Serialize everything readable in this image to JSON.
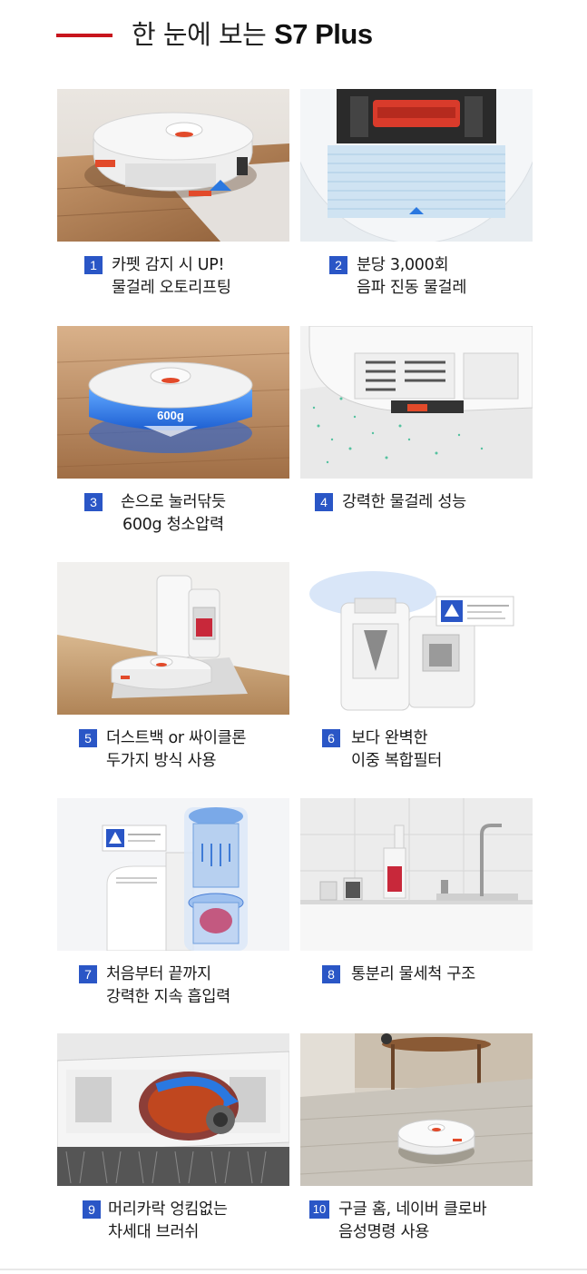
{
  "header": {
    "title_prefix": "한 눈에 보는 ",
    "model": "S7 Plus",
    "accent_color": "#c8151d"
  },
  "badge_color": "#2a56c6",
  "features": [
    {
      "num": "1",
      "lines": [
        "카펫 감지 시 UP!",
        "물걸레 오토리프팅"
      ],
      "photo_badge": ""
    },
    {
      "num": "2",
      "lines": [
        "분당 3,000회",
        "음파 진동 물걸레"
      ],
      "photo_badge": ""
    },
    {
      "num": "3",
      "lines": [
        "손으로 눌러닦듯",
        "600g 청소압력"
      ],
      "photo_badge": "600g"
    },
    {
      "num": "4",
      "lines": [
        "강력한 물걸레 성능"
      ],
      "photo_badge": ""
    },
    {
      "num": "5",
      "lines": [
        "더스트백 or 싸이클론",
        "두가지 방식 사용"
      ],
      "photo_badge": ""
    },
    {
      "num": "6",
      "lines": [
        "보다 완벽한",
        "이중 복합필터"
      ],
      "photo_badge": ""
    },
    {
      "num": "7",
      "lines": [
        "처음부터 끝까지",
        "강력한 지속 흡입력"
      ],
      "photo_badge": ""
    },
    {
      "num": "8",
      "lines": [
        "통분리 물세척 구조"
      ],
      "photo_badge": ""
    },
    {
      "num": "9",
      "lines": [
        "머리카락 엉킴없는",
        "차세대 브러쉬"
      ],
      "photo_badge": ""
    },
    {
      "num": "10",
      "lines": [
        "구글 홈, 네이버 클로바",
        "음성명령 사용"
      ],
      "photo_badge": ""
    }
  ]
}
